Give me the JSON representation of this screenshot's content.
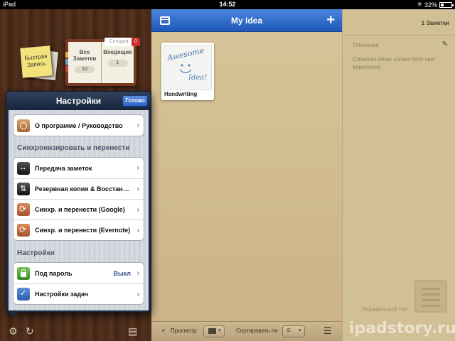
{
  "status_bar": {
    "device": "iPad",
    "time": "14:52",
    "battery": "32%",
    "battery_level": 0.32
  },
  "shelf": {
    "quick_note": "Быстрая Запись",
    "notebook": {
      "all_notes_label": "Все Заметки",
      "all_notes_count": "10",
      "inbox_label": "Входящие",
      "inbox_count": "1",
      "today_label": "Сегодня",
      "today_count": "0"
    }
  },
  "settings": {
    "title": "Настройки",
    "done": "Готово",
    "about": "О программе / Руководство",
    "sync_header": "Синхронизировать и перенести",
    "sync_items": [
      {
        "label": "Передача заметок",
        "icon": "transfer-icon"
      },
      {
        "label": "Резервная копия & Восстан…",
        "icon": "backup-icon"
      },
      {
        "label": "Синхр. и перенести (Google)",
        "icon": "google-sync-icon"
      },
      {
        "label": "Синхр. и перенести (Evernote)",
        "icon": "evernote-sync-icon"
      }
    ],
    "settings_header": "Настройки",
    "password_label": "Под пароль",
    "password_value": "Выкл",
    "tasks_label": "Настройки задач"
  },
  "main": {
    "title": "My Idea",
    "note": {
      "label": "Handwriting",
      "thumb_text1": "Awesome",
      "thumb_text2": "Idea!"
    },
    "bottom": {
      "preview": "Просмотр",
      "sort_by": "Сортировать по"
    }
  },
  "detail": {
    "count": "1 Заметки",
    "description_label": "Описание",
    "description": "Creatives ideas comes from vast experience",
    "type_label": "Нормальный тип"
  },
  "watermark": "ipadstory.ru"
}
